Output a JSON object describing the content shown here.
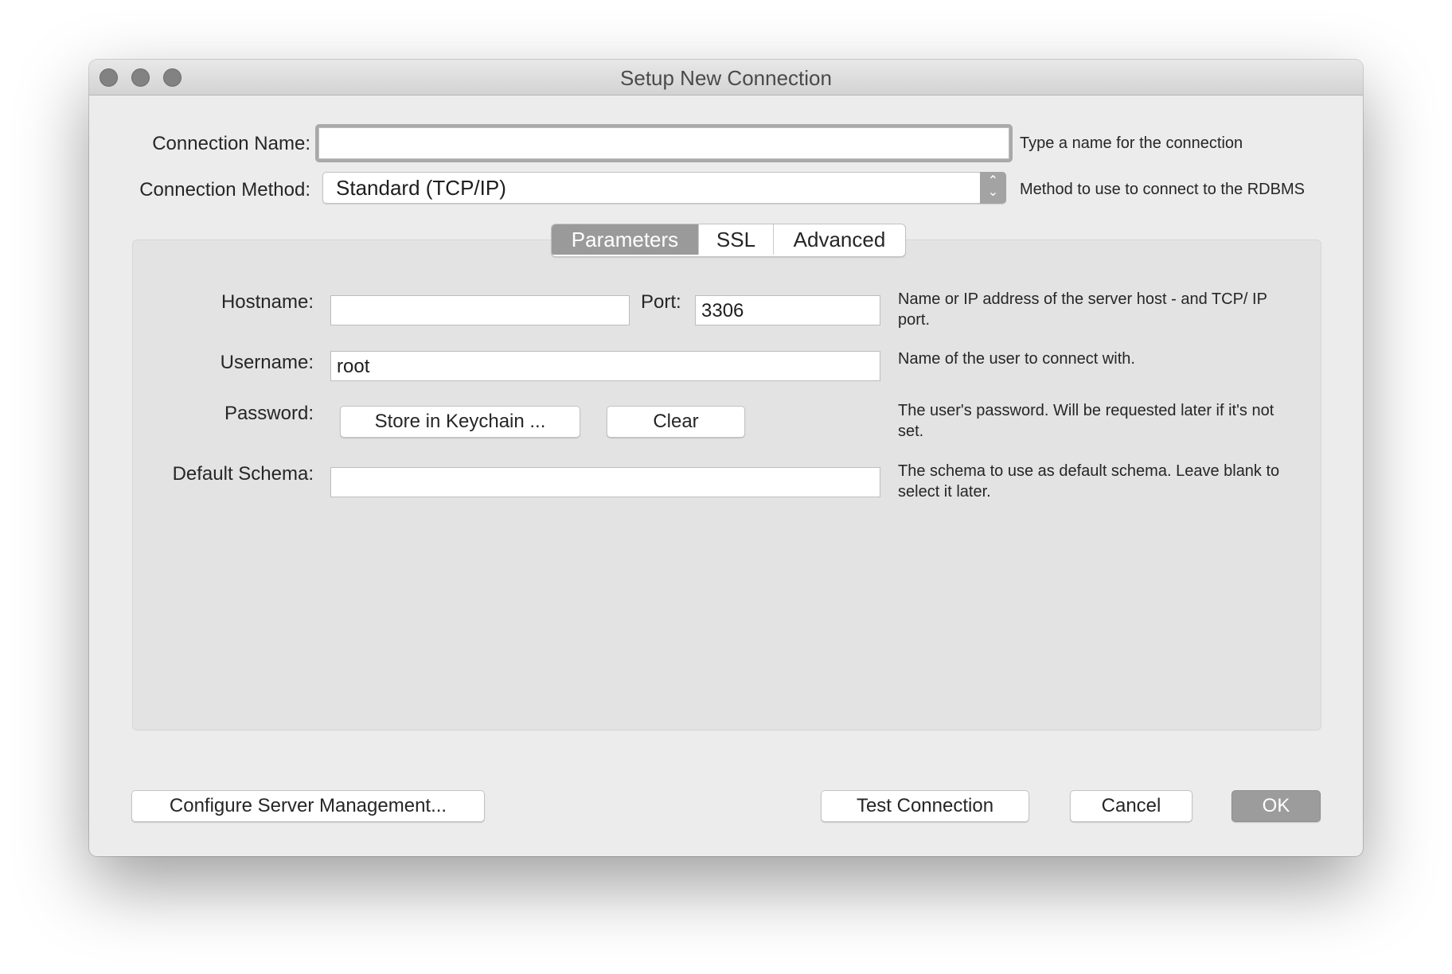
{
  "window": {
    "title": "Setup New Connection"
  },
  "connection_name": {
    "label": "Connection Name:",
    "value": "",
    "hint": "Type a name for the connection"
  },
  "connection_method": {
    "label": "Connection Method:",
    "selected": "Standard (TCP/IP)",
    "hint": "Method to use to connect to the RDBMS"
  },
  "tabs": [
    {
      "label": "Parameters",
      "active": true
    },
    {
      "label": "SSL",
      "active": false
    },
    {
      "label": "Advanced",
      "active": false
    }
  ],
  "parameters": {
    "hostname": {
      "label": "Hostname:",
      "value": ""
    },
    "port": {
      "label": "Port:",
      "value": "3306"
    },
    "hostname_hint": "Name or IP address of the server host - and TCP/ IP port.",
    "username": {
      "label": "Username:",
      "value": "root",
      "hint": "Name of the user to connect with."
    },
    "password": {
      "label": "Password:",
      "store_button": "Store in Keychain ...",
      "clear_button": "Clear",
      "hint": "The user's password. Will be requested later if it's not set."
    },
    "default_schema": {
      "label": "Default Schema:",
      "value": "",
      "hint": "The schema to use as default schema. Leave blank to select it later."
    }
  },
  "footer": {
    "configure_button": "Configure Server Management...",
    "test_button": "Test Connection",
    "cancel_button": "Cancel",
    "ok_button": "OK"
  },
  "icons": {
    "stepper": "chevron-up-down-icon",
    "traffic_lights": [
      "close-icon",
      "minimize-icon",
      "zoom-icon"
    ]
  },
  "colors": {
    "window_bg": "#ececec",
    "panel_bg": "#e3e3e3",
    "active_tab": "#9a9a9a",
    "default_button": "#9c9c9c"
  }
}
